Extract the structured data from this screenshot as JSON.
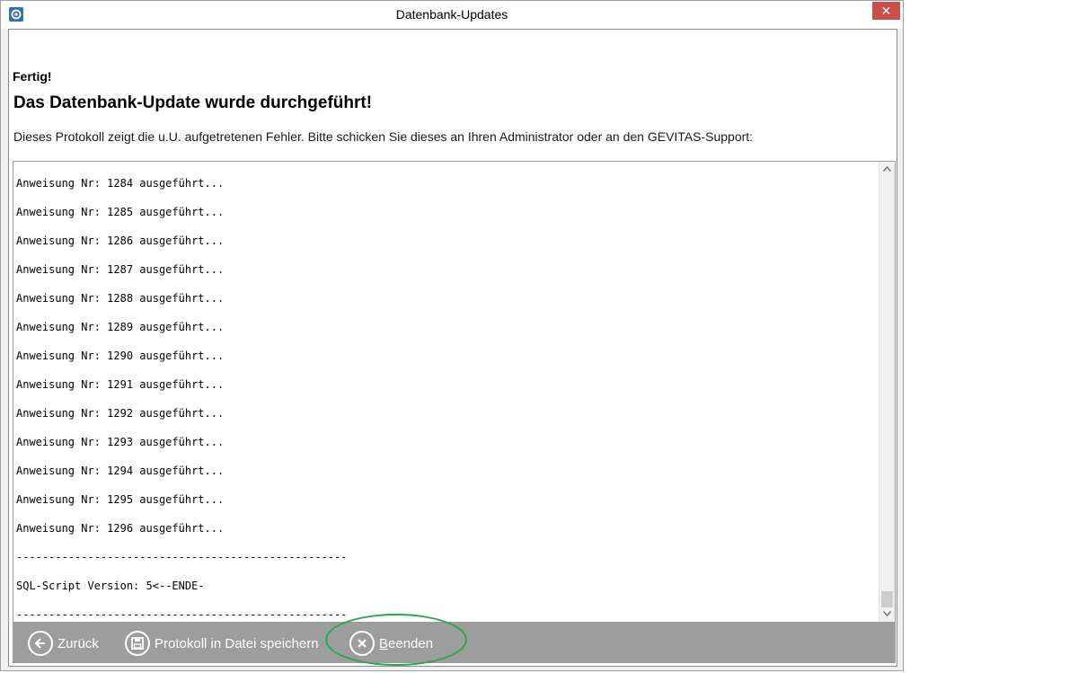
{
  "window": {
    "title": "Datenbank-Updates",
    "close_label": "✕"
  },
  "content": {
    "status": "Fertig!",
    "headline": "Das Datenbank-Update wurde durchgeführt!",
    "description": "Dieses Protokoll zeigt die u.U. aufgetretenen Fehler. Bitte schicken Sie dieses an Ihren Administrator oder an den GEVITAS-Support:"
  },
  "log": {
    "lines": [
      "Anweisung Nr: 1284 ausgeführt...",
      "Anweisung Nr: 1285 ausgeführt...",
      "Anweisung Nr: 1286 ausgeführt...",
      "Anweisung Nr: 1287 ausgeführt...",
      "Anweisung Nr: 1288 ausgeführt...",
      "Anweisung Nr: 1289 ausgeführt...",
      "Anweisung Nr: 1290 ausgeführt...",
      "Anweisung Nr: 1291 ausgeführt...",
      "Anweisung Nr: 1292 ausgeführt...",
      "Anweisung Nr: 1293 ausgeführt...",
      "Anweisung Nr: 1294 ausgeführt...",
      "Anweisung Nr: 1295 ausgeführt...",
      "Anweisung Nr: 1296 ausgeführt...",
      "---------------------------------------------------",
      "SQL-Script Version: 5<--ENDE-",
      "---------------------------------------------------"
    ]
  },
  "buttons": {
    "back_label": "Zurück",
    "save_label": "Protokoll in Datei speichern",
    "exit_label_first": "B",
    "exit_label_rest": "eenden"
  },
  "colors": {
    "bottom_bar": "#9d9d9d",
    "close_button": "#c7504b",
    "highlight": "#2aa84a"
  }
}
